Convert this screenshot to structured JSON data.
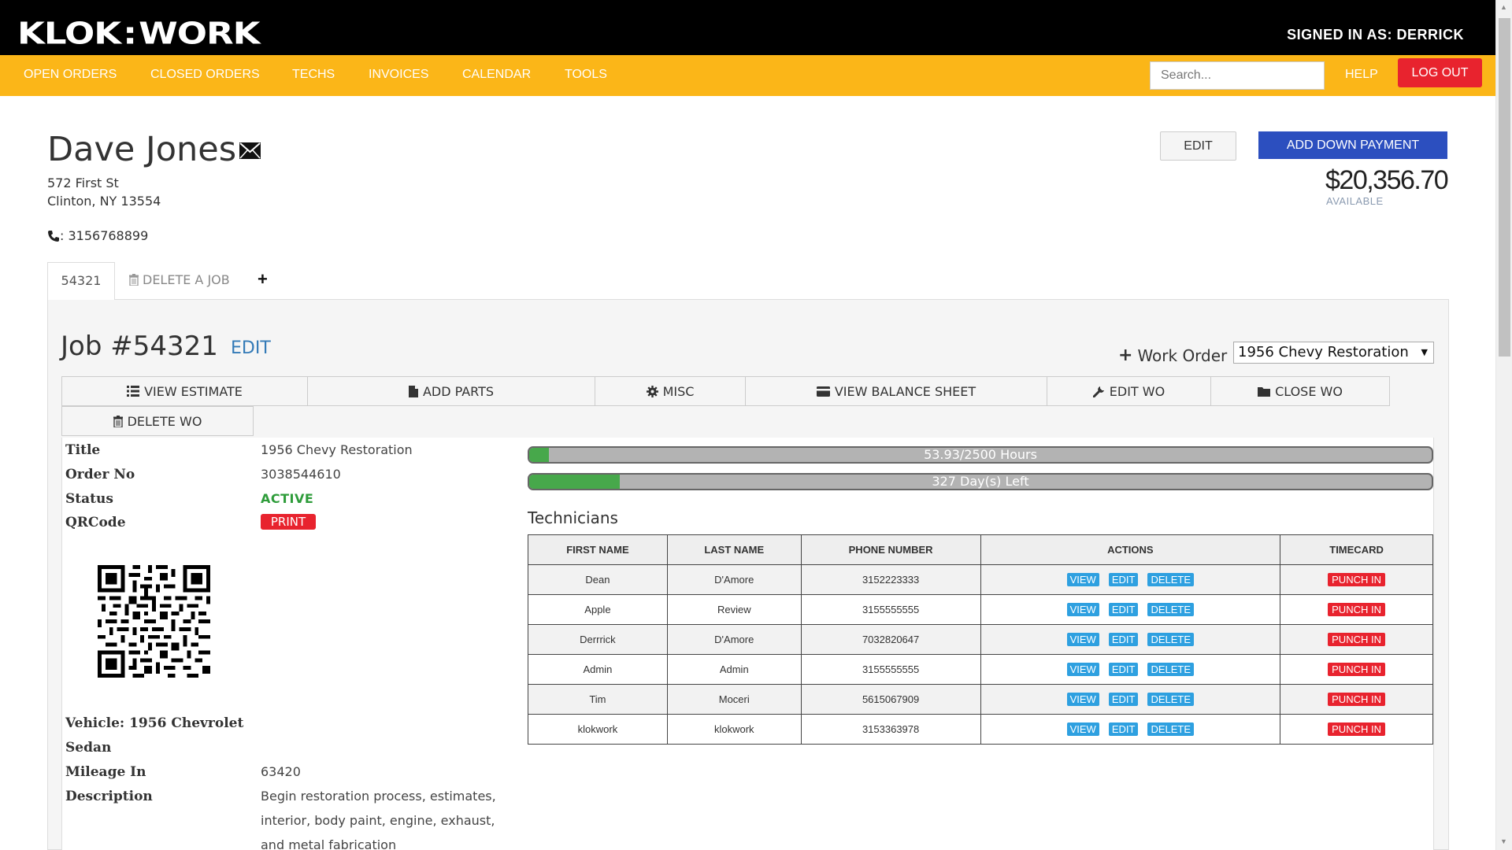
{
  "app": {
    "logo_left": "KLOK",
    "logo_sep": ":",
    "logo_right": "WORK",
    "signed_in": "SIGNED IN AS: DERRICK"
  },
  "nav": {
    "items": [
      "OPEN ORDERS",
      "CLOSED ORDERS",
      "TECHS",
      "INVOICES",
      "CALENDAR",
      "TOOLS"
    ],
    "search_placeholder": "Search...",
    "help": "HELP",
    "logout": "LOG OUT"
  },
  "customer": {
    "name": "Dave Jones",
    "street": "572 First St",
    "city": "Clinton, NY 13554",
    "phone": ": 3156768899",
    "edit_label": "EDIT",
    "down_payment_label": "ADD DOWN PAYMENT",
    "balance": "$20,356.70",
    "available_label": "AVAILABLE"
  },
  "tabs": {
    "active": "54321",
    "delete": "DELETE A JOB",
    "add": "+"
  },
  "job": {
    "title": "Job #54321",
    "edit": "EDIT",
    "wo_label": "Work Order",
    "wo_selected": "1956 Chevy Restoration"
  },
  "toolbar": {
    "view_estimate": "VIEW ESTIMATE",
    "add_parts": "ADD PARTS",
    "misc": "MISC",
    "balance_sheet": "VIEW BALANCE SHEET",
    "edit_wo": "EDIT WO",
    "close_wo": "CLOSE WO",
    "delete_wo": "DELETE WO"
  },
  "details": {
    "title_label": "Title",
    "title_value": "1956 Chevy Restoration",
    "order_label": "Order No",
    "order_value": "3038544610",
    "status_label": "Status",
    "status_value": "ACTIVE",
    "qr_label": "QRCode",
    "print": "PRINT",
    "vehicle_line1": "Vehicle: 1956 Chevrolet",
    "vehicle_line2": "Sedan",
    "mileage_label": "Mileage In",
    "mileage_value": "63420",
    "desc_label": "Description",
    "desc_line1": "Begin restoration process, estimates,",
    "desc_line2": "interior, body paint, engine, exhaust,",
    "desc_line3": "and metal fabrication"
  },
  "progress": {
    "hours_text": "53.93/2500 Hours",
    "hours_fraction": 0.0216,
    "days_text": "327 Day(s) Left",
    "days_fraction": 0.1
  },
  "technicians": {
    "heading": "Technicians",
    "columns": [
      "FIRST NAME",
      "LAST NAME",
      "PHONE NUMBER",
      "ACTIONS",
      "TIMECARD"
    ],
    "view_label": "VIEW",
    "edit_label": "EDIT",
    "delete_label": "DELETE",
    "punch_label": "PUNCH IN",
    "rows": [
      {
        "first": "Dean",
        "last": "D'Amore",
        "phone": "3152223333"
      },
      {
        "first": "Apple",
        "last": "Review",
        "phone": "3155555555"
      },
      {
        "first": "Derrrick",
        "last": "D'Amore",
        "phone": "7032820647"
      },
      {
        "first": "Admin",
        "last": "Admin",
        "phone": "3155555555"
      },
      {
        "first": "Tim",
        "last": "Moceri",
        "phone": "5615067909"
      },
      {
        "first": "klokwork",
        "last": "klokwork",
        "phone": "3153363978"
      }
    ]
  },
  "colors": {
    "nav": "#fbb618",
    "logout": "#e8232e",
    "primary": "#2c4fbf",
    "progress_fill": "#47a84b",
    "action": "#2ea0e0"
  }
}
